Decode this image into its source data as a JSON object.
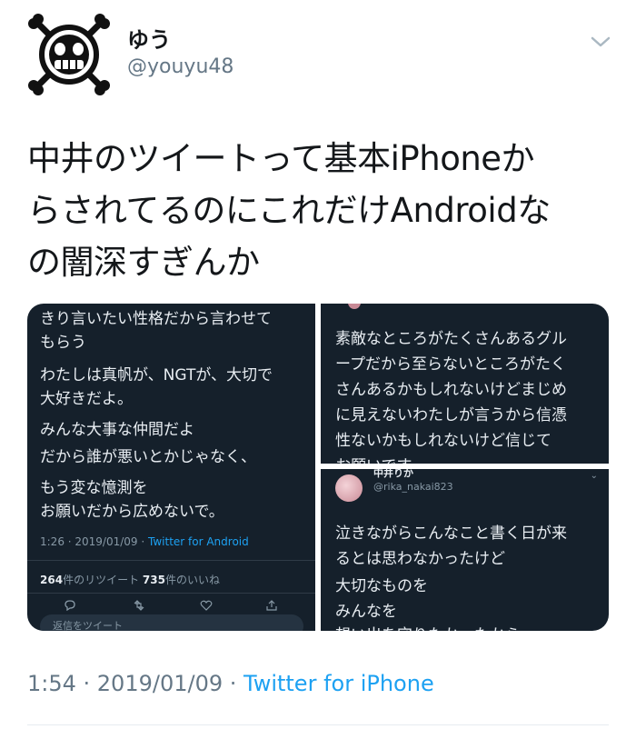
{
  "user": {
    "name": "ゆう",
    "handle": "@youyu48",
    "avatar_icon": "jolly-roger-smiley-icon"
  },
  "tweet": {
    "lines": [
      "中井のツイートって基本iPhoneか",
      "らされてるのにこれだけAndroidな",
      "の闇深すぎんか"
    ]
  },
  "media": {
    "left": {
      "lines": [
        "きり言いたい性格だから言わせて",
        "もらう",
        "わたしは真帆が、NGTが、大切で",
        "大好きだよ。",
        "みんな大事な仲間だよ",
        "だから誰が悪いとかじゃなく、",
        "もう変な憶測を",
        "お願いだから広めないで。"
      ],
      "time": "1:26 · 2019/01/09 · ",
      "source": "Twitter for Android",
      "retweets_count": "264",
      "retweets_label": "件のリツイート",
      "likes_count": "735",
      "likes_label": "件のいいね",
      "reply_placeholder": "返信をツイート"
    },
    "top_right": {
      "lines": [
        "素敵なところがたくさんあるグル",
        "ープだから至らないところがたく",
        "さんあるかもしれないけどまじめ",
        "に見えないわたしが言うから信憑",
        "性ないかもしれないけど信じて",
        "お願いです"
      ]
    },
    "bottom_right": {
      "name": "中井りか",
      "handle": "@rika_nakai823",
      "lines": [
        "泣きながらこんなこと書く日が来",
        "るとは思わなかったけど",
        "大切なものを",
        "みんなを",
        "想い出を守りたかったから"
      ]
    }
  },
  "footer": {
    "time": "1:54 · 2019/01/09 · ",
    "source": "Twitter for iPhone"
  },
  "colors": {
    "link": "#1da1f2",
    "panel_bg": "#15202b",
    "secondary": "#657786"
  }
}
